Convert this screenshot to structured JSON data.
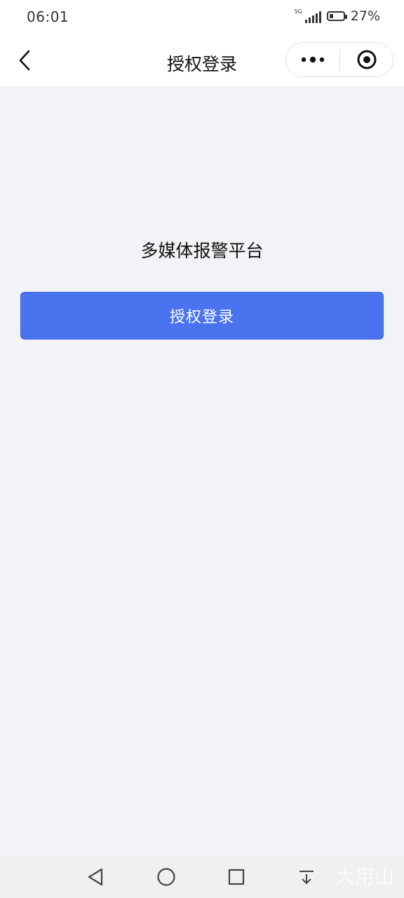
{
  "status_bar": {
    "time": "06:01",
    "network": "5G",
    "battery_percent": "27%",
    "battery_level": 0.27
  },
  "nav_bar": {
    "title": "授权登录",
    "icons": {
      "back": "chevron-left-icon",
      "more": "more-dots-icon",
      "close": "target-circle-icon"
    }
  },
  "main": {
    "app_title": "多媒体报警平台",
    "login_button_label": "授权登录"
  },
  "colors": {
    "primary_button": "#4a73f0",
    "page_background": "#f2f3f7",
    "bar_background": "#ffffff"
  },
  "system_nav": {
    "icons": [
      "back-triangle-icon",
      "home-circle-icon",
      "recent-square-icon",
      "download-icon"
    ],
    "watermark": "大用山"
  }
}
